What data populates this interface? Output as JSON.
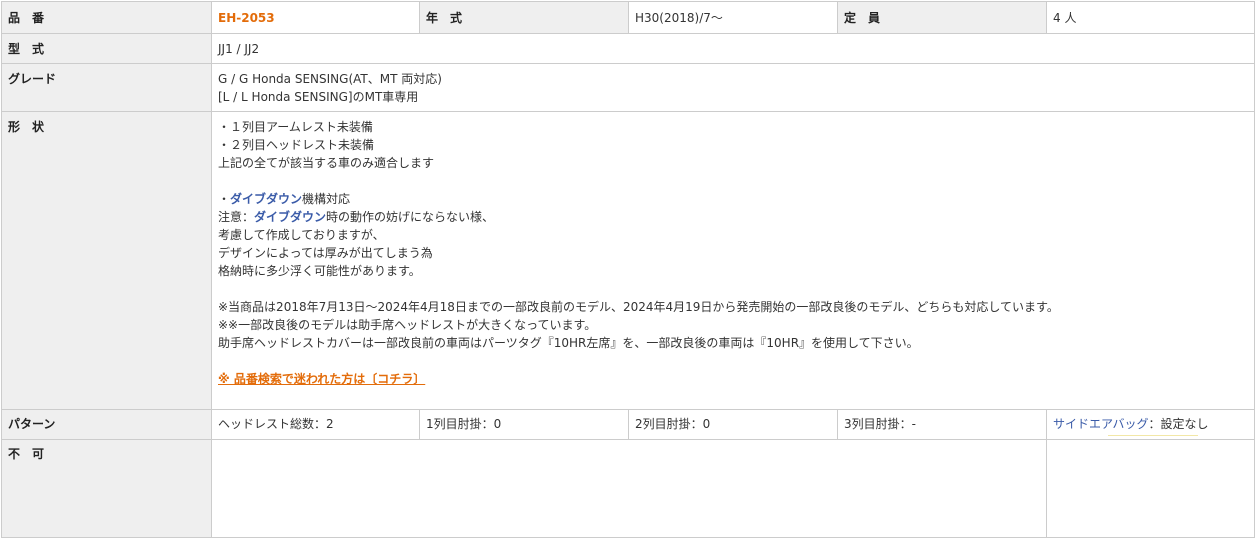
{
  "rows": {
    "part_no": {
      "label": "品　番",
      "value": "EH-2053"
    },
    "year": {
      "label": "年　式",
      "value": "H30(2018)/7～"
    },
    "capacity": {
      "label": "定　員",
      "value": "4 人"
    },
    "model": {
      "label": "型　式",
      "value": "JJ1 / JJ2"
    },
    "grade": {
      "label": "グレード",
      "lines": [
        "G / G Honda SENSING(AT、MT 両対応)",
        "[L / L Honda SENSING]のMT車専用"
      ]
    },
    "shape": {
      "label": "形　状",
      "line1": "・１列目アームレスト未装備",
      "line2": "・２列目ヘッドレスト未装備",
      "line3": "上記の全てが該当する車のみ適合します",
      "dive_prefix": "・",
      "dive_term": "ダイブダウン",
      "dive_suffix": "機構対応",
      "note_prefix": "注意：",
      "note_term": "ダイブダウン",
      "note_suffix": "時の動作の妨げにならない様、",
      "line6": "考慮して作成しておりますが、",
      "line7": "デザインによっては厚みが出てしまう為",
      "line8": "格納時に多少浮く可能性があります。",
      "line9": "※当商品は2018年7月13日～2024年4月18日までの一部改良前のモデル、2024年4月19日から発売開始の一部改良後のモデル、どちらも対応しています。",
      "line10": "※※一部改良後のモデルは助手席ヘッドレストが大きくなっています。",
      "line11": "助手席ヘッドレストカバーは一部改良前の車両はパーツタグ『10HR左席』を、一部改良後の車両は『10HR』を使用して下さい。",
      "link": "※ 品番検索で迷われた方は〔コチラ〕"
    },
    "pattern": {
      "label": "パターン",
      "headrest": "ヘッドレスト総数：2",
      "row1_armrest": "1列目肘掛：0",
      "row2_armrest": "2列目肘掛：0",
      "row3_armrest": "3列目肘掛：-",
      "airbag_term": "サイドエアバッグ",
      "airbag_value": "：設定なし"
    },
    "not_allowed": {
      "label": "不　可"
    }
  }
}
